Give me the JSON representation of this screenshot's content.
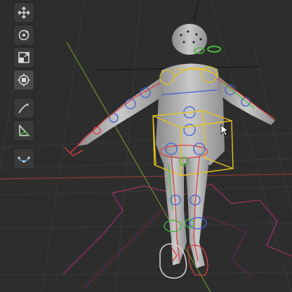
{
  "viewport": {
    "label": "3D Viewport",
    "background": "#2d2d2d",
    "grid_color": "#3a3a3a",
    "axis_x_color": "#9b3a3a",
    "axis_y_color": "#6f8f2a"
  },
  "toolbar": {
    "tools": [
      {
        "name": "move-tool",
        "icon": "move-icon"
      },
      {
        "name": "rotate-tool",
        "icon": "rotate-icon"
      },
      {
        "name": "scale-tool",
        "icon": "scale-icon"
      },
      {
        "name": "transform-tool",
        "icon": "transform-icon"
      },
      {
        "name": "annotate-tool",
        "icon": "annotate-icon"
      },
      {
        "name": "measure-tool",
        "icon": "measure-icon"
      },
      {
        "name": "curve-tool",
        "icon": "curve-icon"
      }
    ]
  },
  "scene": {
    "object": "character-mesh",
    "rig_colors": {
      "ik_control": "#d84040",
      "fk_control": "#4060d8",
      "selected_box": "#e6c21a",
      "green_control": "#46b83a",
      "foot_ring": "#d8d8d8",
      "ground_outline": "#a0306a"
    }
  }
}
